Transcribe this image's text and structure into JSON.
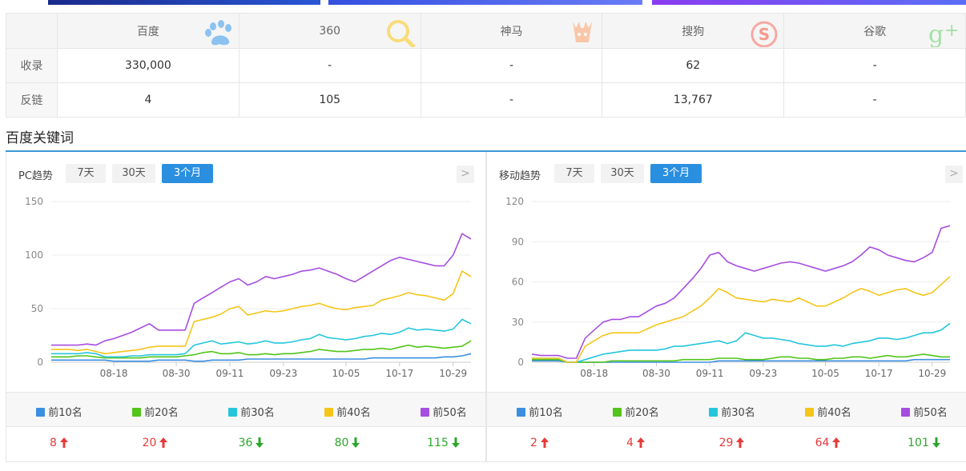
{
  "colors": {
    "accent": "#2b8fe0",
    "top10": "#3b8fe0",
    "top20": "#52c41a",
    "top30": "#25c6dc",
    "top40": "#f5c518",
    "top50": "#a64ee0",
    "up": "#e83a3a",
    "down": "#2aa62a"
  },
  "engines": {
    "headers": [
      "百度",
      "360",
      "神马",
      "搜狗",
      "谷歌"
    ],
    "icons": [
      "paw-icon",
      "magnifier-icon",
      "deer-icon",
      "sogou-s-icon",
      "google-plus-icon"
    ],
    "rows": [
      {
        "label": "收录",
        "values": [
          "330,000",
          "-",
          "-",
          "62",
          "-"
        ]
      },
      {
        "label": "反链",
        "values": [
          "4",
          "105",
          "-",
          "13,767",
          "-"
        ]
      }
    ]
  },
  "section": {
    "title": "百度关键词"
  },
  "range_buttons": [
    "7天",
    "30天",
    "3个月"
  ],
  "active_range": "3个月",
  "pc": {
    "title": "PC趋势",
    "legend": [
      "前10名",
      "前20名",
      "前30名",
      "前40名",
      "前50名"
    ],
    "stats": [
      {
        "value": "8",
        "dir": "up"
      },
      {
        "value": "20",
        "dir": "up"
      },
      {
        "value": "36",
        "dir": "down"
      },
      {
        "value": "80",
        "dir": "down"
      },
      {
        "value": "115",
        "dir": "down"
      }
    ]
  },
  "mobile": {
    "title": "移动趋势",
    "legend": [
      "前10名",
      "前20名",
      "前30名",
      "前40名",
      "前50名"
    ],
    "stats": [
      {
        "value": "2",
        "dir": "up"
      },
      {
        "value": "4",
        "dir": "up"
      },
      {
        "value": "29",
        "dir": "up"
      },
      {
        "value": "64",
        "dir": "up"
      },
      {
        "value": "101",
        "dir": "down"
      }
    ]
  },
  "chart_data": [
    {
      "type": "line",
      "title": "",
      "x_ticks": [
        "08-18",
        "08-30",
        "09-11",
        "09-23",
        "10-05",
        "10-17",
        "10-29"
      ],
      "ylim": [
        0,
        150
      ],
      "y_ticks": [
        0,
        50,
        100,
        150
      ],
      "grid": true,
      "series": [
        {
          "name": "前10名",
          "values": [
            2,
            2,
            2,
            2,
            2,
            2,
            2,
            1,
            1,
            1,
            1,
            1,
            2,
            2,
            2,
            2,
            1,
            1,
            2,
            2,
            2,
            2,
            3,
            3,
            3,
            3,
            3,
            3,
            3,
            3,
            3,
            3,
            3,
            3,
            3,
            3,
            4,
            4,
            4,
            4,
            4,
            4,
            4,
            4,
            5,
            5,
            6,
            8
          ]
        },
        {
          "name": "前20名",
          "values": [
            5,
            5,
            5,
            6,
            6,
            5,
            4,
            4,
            4,
            4,
            4,
            5,
            5,
            5,
            5,
            6,
            7,
            9,
            10,
            8,
            8,
            9,
            7,
            7,
            8,
            7,
            8,
            8,
            9,
            10,
            12,
            11,
            10,
            10,
            11,
            12,
            12,
            13,
            12,
            14,
            16,
            14,
            15,
            14,
            13,
            14,
            15,
            20
          ]
        },
        {
          "name": "前30名",
          "values": [
            8,
            8,
            8,
            8,
            9,
            8,
            5,
            5,
            5,
            6,
            6,
            7,
            7,
            7,
            7,
            8,
            16,
            18,
            20,
            17,
            18,
            19,
            17,
            18,
            20,
            18,
            18,
            19,
            21,
            22,
            26,
            23,
            22,
            21,
            22,
            24,
            25,
            27,
            26,
            28,
            32,
            30,
            31,
            30,
            29,
            31,
            40,
            36
          ]
        },
        {
          "name": "前40名",
          "values": [
            12,
            12,
            12,
            11,
            12,
            10,
            8,
            9,
            10,
            11,
            12,
            14,
            15,
            15,
            15,
            15,
            38,
            40,
            42,
            45,
            50,
            52,
            44,
            46,
            48,
            47,
            48,
            50,
            52,
            53,
            55,
            52,
            50,
            49,
            51,
            52,
            53,
            58,
            60,
            62,
            65,
            63,
            62,
            60,
            58,
            64,
            85,
            80
          ]
        },
        {
          "name": "前50名",
          "values": [
            16,
            16,
            16,
            16,
            17,
            16,
            20,
            22,
            25,
            28,
            32,
            36,
            30,
            30,
            30,
            30,
            55,
            60,
            65,
            70,
            75,
            78,
            72,
            75,
            80,
            78,
            80,
            82,
            85,
            86,
            88,
            85,
            82,
            78,
            75,
            80,
            85,
            90,
            95,
            98,
            96,
            94,
            92,
            90,
            90,
            100,
            120,
            115
          ]
        }
      ]
    },
    {
      "type": "line",
      "title": "",
      "x_ticks": [
        "08-18",
        "08-30",
        "09-11",
        "09-23",
        "10-05",
        "10-17",
        "10-29"
      ],
      "ylim": [
        0,
        120
      ],
      "y_ticks": [
        0,
        30,
        60,
        90,
        120
      ],
      "grid": true,
      "series": [
        {
          "name": "前10名",
          "values": [
            1,
            1,
            1,
            1,
            0,
            0,
            0,
            0,
            0,
            0,
            0,
            0,
            0,
            0,
            0,
            0,
            0,
            0,
            0,
            0,
            0,
            1,
            1,
            1,
            1,
            1,
            1,
            1,
            1,
            1,
            1,
            1,
            1,
            1,
            1,
            1,
            1,
            1,
            1,
            1,
            1,
            1,
            1,
            2,
            2,
            2,
            2,
            2
          ]
        },
        {
          "name": "前20名",
          "values": [
            2,
            2,
            2,
            2,
            0,
            0,
            0,
            0,
            0,
            1,
            1,
            1,
            1,
            1,
            1,
            1,
            1,
            2,
            2,
            2,
            2,
            3,
            3,
            3,
            2,
            2,
            2,
            3,
            4,
            4,
            3,
            3,
            2,
            2,
            3,
            3,
            4,
            4,
            3,
            4,
            5,
            4,
            4,
            5,
            6,
            5,
            4,
            4
          ]
        },
        {
          "name": "前30名",
          "values": [
            3,
            3,
            3,
            3,
            0,
            0,
            2,
            4,
            6,
            7,
            8,
            9,
            9,
            9,
            9,
            10,
            12,
            12,
            13,
            14,
            15,
            16,
            14,
            16,
            22,
            20,
            18,
            18,
            17,
            16,
            14,
            13,
            12,
            12,
            13,
            12,
            14,
            15,
            16,
            18,
            18,
            17,
            18,
            20,
            22,
            22,
            24,
            29
          ]
        },
        {
          "name": "前40名",
          "values": [
            3,
            3,
            3,
            3,
            0,
            0,
            12,
            16,
            20,
            22,
            22,
            22,
            22,
            25,
            28,
            30,
            32,
            34,
            38,
            42,
            48,
            55,
            52,
            48,
            47,
            46,
            45,
            47,
            46,
            45,
            48,
            45,
            42,
            42,
            45,
            48,
            52,
            55,
            53,
            50,
            52,
            54,
            55,
            52,
            50,
            52,
            58,
            64
          ]
        },
        {
          "name": "前50名",
          "values": [
            6,
            5,
            5,
            5,
            3,
            3,
            18,
            24,
            30,
            32,
            32,
            34,
            34,
            38,
            42,
            44,
            48,
            55,
            62,
            70,
            80,
            82,
            75,
            72,
            70,
            68,
            70,
            72,
            74,
            75,
            74,
            72,
            70,
            68,
            70,
            72,
            75,
            80,
            86,
            84,
            80,
            78,
            76,
            75,
            78,
            82,
            100,
            102
          ]
        }
      ]
    }
  ]
}
